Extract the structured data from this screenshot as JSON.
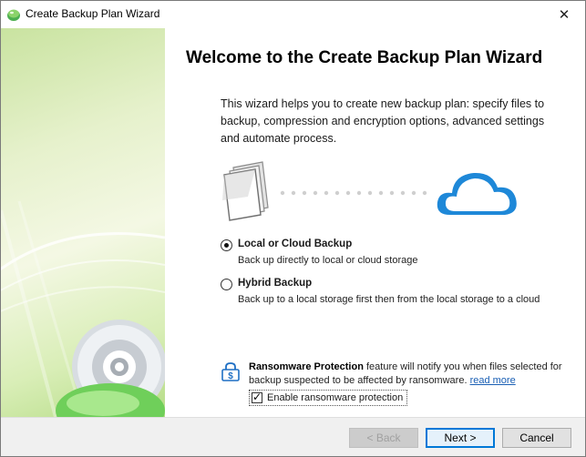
{
  "window": {
    "title": "Create Backup Plan Wizard",
    "close_glyph": "✕"
  },
  "heading": "Welcome to the Create Backup Plan Wizard",
  "intro": "This wizard helps you to create new backup plan: specify files to backup, compression and encryption options, advanced settings and automate process.",
  "illustration": {
    "left_icon": "files-icon",
    "right_icon": "cloud-icon",
    "accent": "#1e88d8"
  },
  "options": [
    {
      "label": "Local or Cloud Backup",
      "description": "Back up directly to local or cloud storage",
      "selected": true
    },
    {
      "label": "Hybrid Backup",
      "description": "Back up to a local storage first then from the local storage to a cloud",
      "selected": false
    }
  ],
  "ransomware": {
    "title": "Ransomware Protection",
    "text": " feature will notify you when files selected for backup suspected to be affected by ransomware. ",
    "link": "read more",
    "checkbox_label": "Enable ransomware protection",
    "checked": true
  },
  "buttons": {
    "back": "< Back",
    "next": "Next >",
    "cancel": "Cancel"
  }
}
